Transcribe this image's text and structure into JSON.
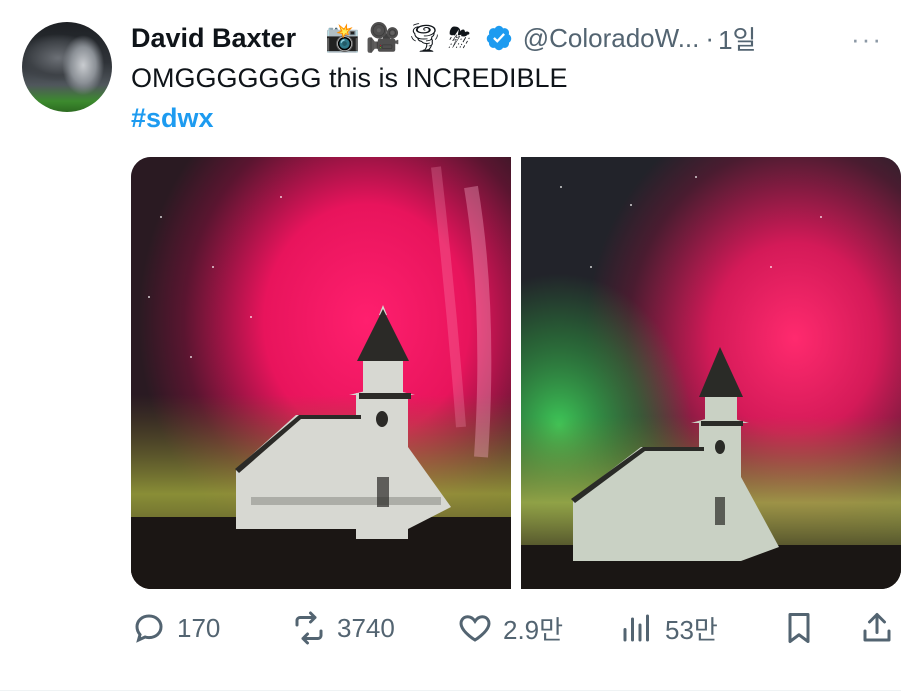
{
  "tweet": {
    "author_name": "David Baxter",
    "author_emojis": [
      "📸",
      "🎥",
      "🌪",
      "⛈"
    ],
    "handle": "@ColoradoW...",
    "separator": "·",
    "time": "1일",
    "more_label": "···",
    "text": "OMGGGGGGG this is INCREDIBLE",
    "hashtag": "#sdwx"
  },
  "media": [
    {
      "icon": "aurora-church-photo"
    },
    {
      "icon": "aurora-church-photo"
    }
  ],
  "actions": {
    "replies": "170",
    "retweets": "3740",
    "likes": "2.9만",
    "views": "53만"
  },
  "colors": {
    "link": "#1d9bf0",
    "muted": "#536471",
    "verified": "#1d9bf0"
  }
}
